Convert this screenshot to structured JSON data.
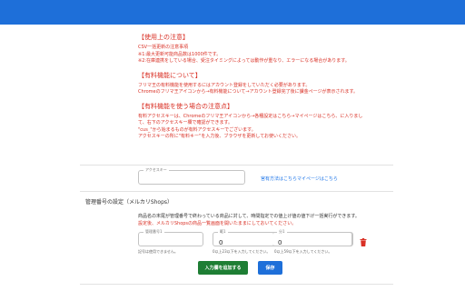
{
  "notes": {
    "usage_title": "【使用上の注意】",
    "usage_lines": [
      "CSV一括更新の注意事項",
      "※1:最大更新可能商品数は1000件です。",
      "※2:在庫連携をしている場合、受注タイミングによっては動作が重なり、エラーになる場合があります。"
    ],
    "paid_title": "【有料機能について】",
    "paid_lines": [
      "フリマ王の有料機能を使用するにはアカウント登録をしていただく必要があります。",
      "Chromeのフリマ王アイコンから→有料機能について→アカウント登録完了後に課金ページが表示されます。"
    ],
    "caution_title": "【有料機能を使う場合の注意点】",
    "caution_lines": [
      "有料アクセスキーは、Chromeのフリマ王アイコンから→各種設定はこちら→マイページはこちら、に入りまして、右下のアクセスキー欄で確認ができます。",
      "\"cus_\"から始まるものが有料アクセスキーでございます。",
      "アクセスキーの所に\"有料キー\"を入力後、ブラウザを更新してお使いください。"
    ]
  },
  "access_key": {
    "label": "アクセスキー",
    "value": "",
    "purchase_link": "宮有方法はこちら",
    "mypage_link": "マイページはこちら"
  },
  "management": {
    "title": "管理番号の設定（メルカリShops）",
    "desc1": "商品名の末尾が管理番号で終わっている商品に対して、時間指定での値上げ値の値下げ一括実行ができます。",
    "desc2": "設定後、メルカリShopsの商品一覧画面を開いたままにしておいてください。",
    "row": {
      "manage_label": "管理番号1",
      "manage_value": "",
      "manage_helper": "記号は使用できません。",
      "min_label": "範1",
      "min_value": "0",
      "min_helper": "0以上23以下を入力してください。",
      "max_label": "分1",
      "max_value": "0",
      "max_helper": "0以上59以下を入力してください。"
    },
    "add_button": "入力欄を追加する",
    "save_button": "保存"
  },
  "colors": {
    "topbar": "#1e6fd9",
    "notice_red": "#d93025",
    "add_green": "#1e7e34",
    "save_blue": "#1e6fd9"
  },
  "icons": {
    "delete": "trash-icon"
  }
}
